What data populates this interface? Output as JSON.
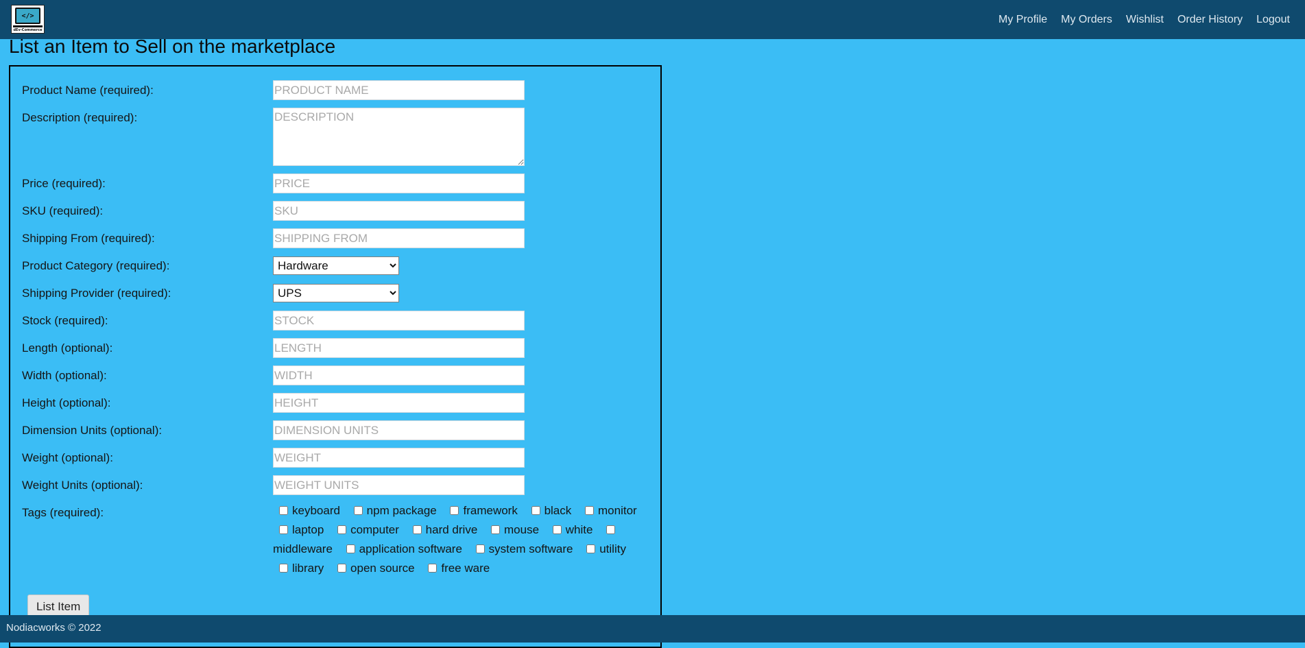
{
  "header": {
    "logo_text": "</>",
    "logo_brand": "dEv-Commerce",
    "nav": [
      "My Profile",
      "My Orders",
      "Wishlist",
      "Order History",
      "Logout"
    ]
  },
  "page_title": "List an Item to Sell on the marketplace",
  "form": {
    "fields": [
      {
        "label": "Product Name (required):",
        "placeholder": "PRODUCT NAME",
        "value": ""
      },
      {
        "label": "Description (required):",
        "placeholder": "DESCRIPTION",
        "value": ""
      },
      {
        "label": "Price (required):",
        "placeholder": "PRICE",
        "value": ""
      },
      {
        "label": "SKU (required):",
        "placeholder": "SKU",
        "value": ""
      },
      {
        "label": "Shipping From (required):",
        "placeholder": "SHIPPING FROM",
        "value": ""
      },
      {
        "label": "Product Category (required):",
        "selected": "Hardware"
      },
      {
        "label": "Shipping Provider (required):",
        "selected": "UPS"
      },
      {
        "label": "Stock (required):",
        "placeholder": "STOCK",
        "value": ""
      },
      {
        "label": "Length (optional):",
        "placeholder": "LENGTH",
        "value": ""
      },
      {
        "label": "Width (optional):",
        "placeholder": "WIDTH",
        "value": ""
      },
      {
        "label": "Height (optional):",
        "placeholder": "HEIGHT",
        "value": ""
      },
      {
        "label": "Dimension Units (optional):",
        "placeholder": "DIMENSION UNITS",
        "value": ""
      },
      {
        "label": "Weight (optional):",
        "placeholder": "WEIGHT",
        "value": ""
      },
      {
        "label": "Weight Units (optional):",
        "placeholder": "WEIGHT UNITS",
        "value": ""
      }
    ],
    "tags_label": "Tags (required):",
    "tags": [
      "keyboard",
      "npm package",
      "framework",
      "black",
      "monitor",
      "laptop",
      "computer",
      "hard drive",
      "mouse",
      "white",
      "middleware",
      "application software",
      "system software",
      "utility",
      "library",
      "open source",
      "free ware"
    ],
    "submit_label": "List Item"
  },
  "footer": {
    "text": "Nodiacworks © 2022"
  }
}
